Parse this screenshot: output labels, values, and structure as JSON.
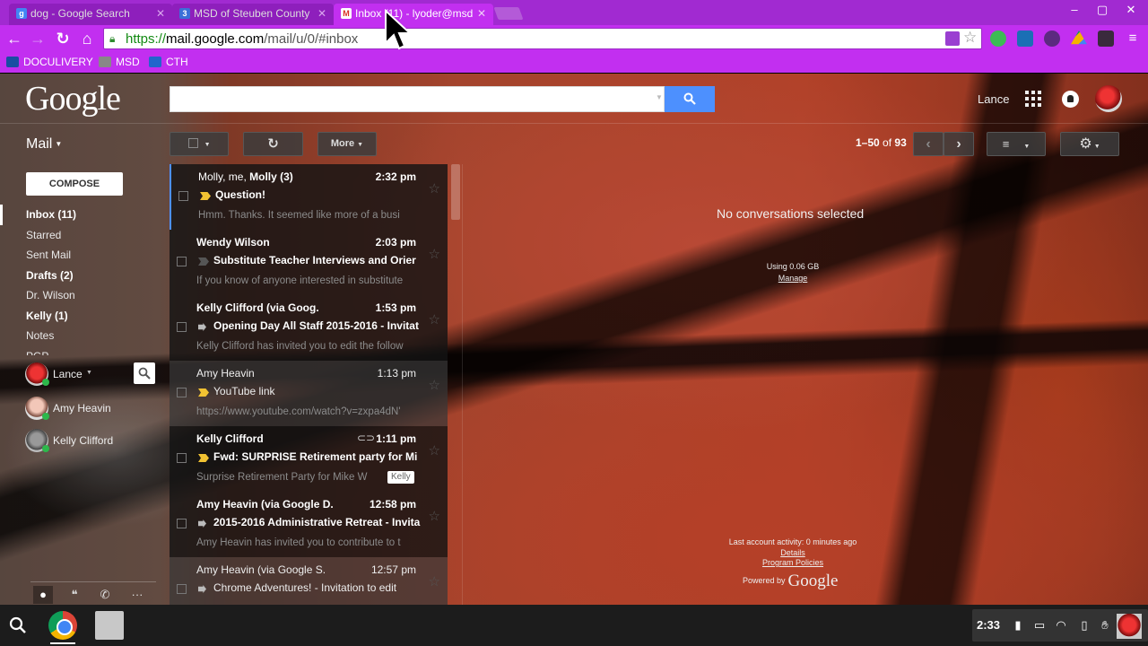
{
  "browser": {
    "tabs": [
      {
        "title": "dog - Google Search",
        "favicon": "g",
        "favicon_color": "#4285f4",
        "active": false
      },
      {
        "title": "MSD of Steuben County",
        "favicon": "3",
        "favicon_color": "#3b6fd8",
        "active": false
      },
      {
        "title": "Inbox (11) - lyoder@msd",
        "favicon": "M",
        "favicon_color": "#d93025",
        "active": true
      }
    ],
    "url_scheme": "https://",
    "url_host": "mail.google.com",
    "url_path": "/mail/u/0/#inbox",
    "bookmarks": [
      {
        "label": "DOCULIVERY",
        "icon_color": "#1a4ea3"
      },
      {
        "label": "MSD",
        "icon_color": "#888"
      },
      {
        "label": "CTH",
        "icon_color": "#2266cc"
      }
    ]
  },
  "header": {
    "logo": "Google",
    "user_name": "Lance"
  },
  "toolbar": {
    "mail_label": "Mail",
    "more_label": "More",
    "pager_range": "1–50",
    "pager_of": "of",
    "pager_total": "93"
  },
  "sidebar": {
    "compose_label": "COMPOSE",
    "labels": [
      {
        "name": "Inbox (11)",
        "bold": true,
        "active": true
      },
      {
        "name": "Starred",
        "bold": false
      },
      {
        "name": "Sent Mail",
        "bold": false
      },
      {
        "name": "Drafts (2)",
        "bold": true
      },
      {
        "name": "Dr. Wilson",
        "bold": false
      },
      {
        "name": "Kelly (1)",
        "bold": true
      },
      {
        "name": "Notes",
        "bold": false
      },
      {
        "name": "PGP",
        "bold": false
      }
    ],
    "chat_me": "Lance",
    "contacts": [
      {
        "name": "Amy Heavin",
        "status_color": "#2db84b"
      },
      {
        "name": "Kelly Clifford",
        "status_color": "#2db84b"
      }
    ]
  },
  "messages": [
    {
      "from": "Molly, me, Molly (3)",
      "time": "2:32 pm",
      "subject": "Question!",
      "snippet": "Hmm. Thanks. It seemed like more of a busi",
      "unread": true,
      "importance": "yes",
      "from_plain_prefix": "Molly, me, "
    },
    {
      "from": "Wendy Wilson",
      "time": "2:03 pm",
      "subject": "Substitute Teacher Interviews and Orier",
      "snippet": "If you know of anyone interested in substitute",
      "unread": true,
      "importance": "no"
    },
    {
      "from": "Kelly Clifford (via Goog.",
      "time": "1:53 pm",
      "subject": "Opening Day All Staff 2015-2016 - Invitat",
      "snippet": "Kelly Clifford has invited you to edit the follow",
      "unread": true,
      "importance": "fwd"
    },
    {
      "from": "Amy Heavin",
      "time": "1:13 pm",
      "subject": "YouTube link",
      "snippet": "https://www.youtube.com/watch?v=zxpa4dN'",
      "unread": false,
      "importance": "yes"
    },
    {
      "from": "Kelly Clifford",
      "time": "1:11 pm",
      "subject": "Fwd: SURPRISE Retirement party for Mi",
      "snippet": "Surprise Retirement Party for Mike W",
      "unread": true,
      "importance": "yes",
      "tag": "Kelly",
      "attachment": true
    },
    {
      "from": "Amy Heavin (via Google D.",
      "time": "12:58 pm",
      "subject": "2015-2016 Administrative Retreat - Invita",
      "snippet": "Amy Heavin has invited you to contribute to t",
      "unread": true,
      "importance": "fwd"
    },
    {
      "from": "Amy Heavin (via Google S.",
      "time": "12:57 pm",
      "subject": "Chrome Adventures! - Invitation to edit",
      "snippet": "",
      "unread": false,
      "importance": "fwd"
    }
  ],
  "reading_pane": {
    "empty_text": "No conversations selected",
    "storage_used": "Using 0.06 GB",
    "manage_link": "Manage",
    "last_activity": "Last account activity: 0 minutes ago",
    "details_link": "Details",
    "policies_link": "Program Policies",
    "powered_by": "Powered by",
    "powered_logo": "Google"
  },
  "shelf": {
    "clock": "2:33"
  }
}
